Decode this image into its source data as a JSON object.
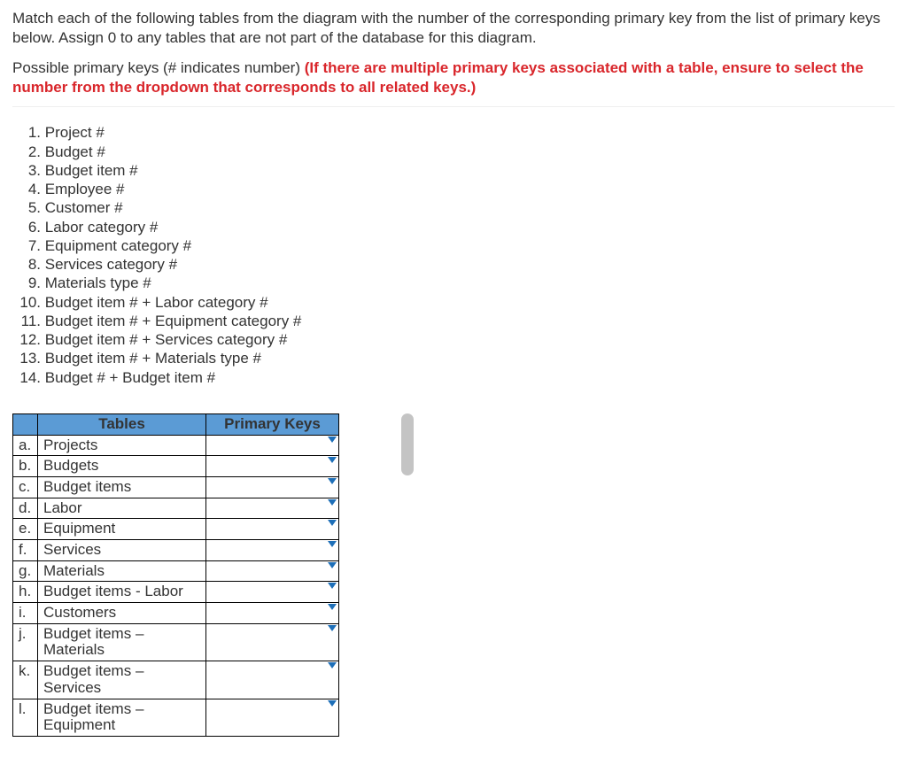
{
  "instructions": "Match each of the following tables from the diagram with the number of the corresponding primary key from the list of primary keys below. Assign 0 to any tables that are not part of the database for this diagram.",
  "sub_instructions_black": "Possible primary keys (# indicates number) ",
  "sub_instructions_red": "(If there are multiple primary keys associated with a table, ensure to select the number from the dropdown that corresponds to all related keys.)",
  "primary_keys": [
    {
      "n": "1.",
      "text": "Project #"
    },
    {
      "n": "2.",
      "text": "Budget #"
    },
    {
      "n": "3.",
      "text": "Budget item #"
    },
    {
      "n": "4.",
      "text": "Employee #"
    },
    {
      "n": "5.",
      "text": "Customer #"
    },
    {
      "n": "6.",
      "text": "Labor category #"
    },
    {
      "n": "7.",
      "text": "Equipment category #"
    },
    {
      "n": "8.",
      "text": "Services category #"
    },
    {
      "n": "9.",
      "text": "Materials type #"
    },
    {
      "n": "10.",
      "text": "Budget item # + Labor category #"
    },
    {
      "n": "11.",
      "text": "Budget item # + Equipment category #"
    },
    {
      "n": "12.",
      "text": "Budget item # + Services category #"
    },
    {
      "n": "13.",
      "text": "Budget item # + Materials type #"
    },
    {
      "n": "14.",
      "text": "Budget # + Budget item #"
    }
  ],
  "table_headers": {
    "tables": "Tables",
    "primary_keys": "Primary Keys"
  },
  "rows": [
    {
      "letter": "a.",
      "name": "Projects"
    },
    {
      "letter": "b.",
      "name": "Budgets"
    },
    {
      "letter": "c.",
      "name": "Budget items"
    },
    {
      "letter": "d.",
      "name": "Labor"
    },
    {
      "letter": "e.",
      "name": "Equipment"
    },
    {
      "letter": "f.",
      "name": "Services"
    },
    {
      "letter": "g.",
      "name": "Materials"
    },
    {
      "letter": "h.",
      "name": "Budget items - Labor"
    },
    {
      "letter": "i.",
      "name": "Customers"
    },
    {
      "letter": "j.",
      "name": "Budget items – Materials"
    },
    {
      "letter": "k.",
      "name": "Budget items – Services"
    },
    {
      "letter": "l.",
      "name": "Budget items – Equipment"
    }
  ]
}
